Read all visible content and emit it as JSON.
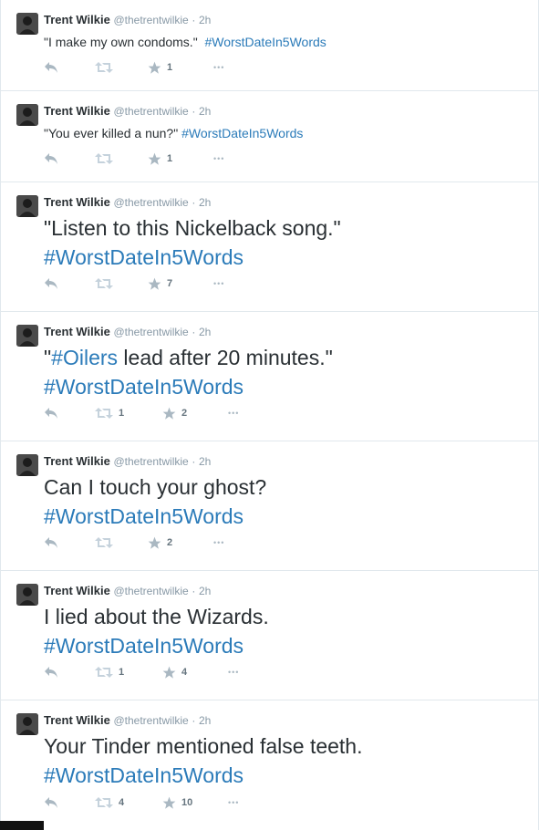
{
  "colors": {
    "link": "#2b7bb9",
    "meta": "#8899a6",
    "text": "#292f33",
    "divider": "#e1e8ed",
    "action": "#aab8c2"
  },
  "icons": {
    "reply": "reply-icon",
    "retweet": "retweet-icon",
    "favorite": "star-icon",
    "more": "more-icon"
  },
  "tweets": [
    {
      "name": "Trent Wilkie",
      "handle": "@thetrentwilkie",
      "sep": "·",
      "time": "2h",
      "text": "\"I make my own condoms.\"  ",
      "hashtag": "#WorstDateIn5Words",
      "retweets": "",
      "favorites": "1",
      "more": "•••"
    },
    {
      "name": "Trent Wilkie",
      "handle": "@thetrentwilkie",
      "sep": "·",
      "time": "2h",
      "text": "\"You ever killed a nun?\" ",
      "hashtag": "#WorstDateIn5Words",
      "retweets": "",
      "favorites": "1",
      "more": "•••"
    },
    {
      "name": "Trent Wilkie",
      "handle": "@thetrentwilkie",
      "sep": "·",
      "time": "2h",
      "text": "\"Listen to this Nickelback song.\"",
      "hashtag": "#WorstDateIn5Words",
      "retweets": "",
      "favorites": "7",
      "more": "•••"
    },
    {
      "name": "Trent Wilkie",
      "handle": "@thetrentwilkie",
      "sep": "·",
      "time": "2h",
      "text_pre": "\"",
      "inline_hashtag": "#Oilers",
      "text_post": " lead after 20 minutes.\"",
      "hashtag": "#WorstDateIn5Words",
      "retweets": "1",
      "favorites": "2",
      "more": "•••"
    },
    {
      "name": "Trent Wilkie",
      "handle": "@thetrentwilkie",
      "sep": "·",
      "time": "2h",
      "text": "Can I touch your ghost?",
      "hashtag": "#WorstDateIn5Words",
      "retweets": "",
      "favorites": "2",
      "more": "•••"
    },
    {
      "name": "Trent Wilkie",
      "handle": "@thetrentwilkie",
      "sep": "·",
      "time": "2h",
      "text": "I lied about the Wizards.",
      "hashtag": "#WorstDateIn5Words",
      "retweets": "1",
      "favorites": "4",
      "more": "•••"
    },
    {
      "name": "Trent Wilkie",
      "handle": "@thetrentwilkie",
      "sep": "·",
      "time": "2h",
      "text": "Your Tinder mentioned false teeth.",
      "hashtag": "#WorstDateIn5Words",
      "retweets": "4",
      "favorites": "10",
      "more": "•••"
    }
  ]
}
